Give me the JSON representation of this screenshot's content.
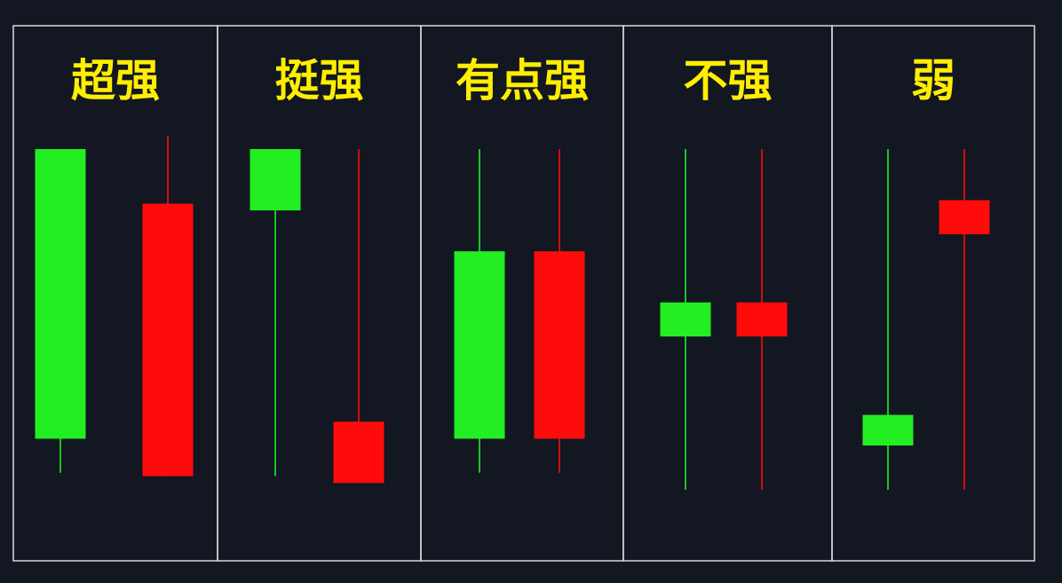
{
  "colors": {
    "background": "#121722",
    "panel_border": "#d8d8d8",
    "title": "#ffee00",
    "up": "#22ee22",
    "down": "#ff0b0b"
  },
  "panels": [
    {
      "title": "超强",
      "candles": [
        {
          "color": "up",
          "wick_top": 0,
          "wick_bottom": 0.95,
          "body_top": 0,
          "body_bottom": 0.85
        },
        {
          "color": "down",
          "wick_top": -0.04,
          "wick_bottom": 0.96,
          "body_top": 0.16,
          "body_bottom": 0.96
        }
      ]
    },
    {
      "title": "挺强",
      "candles": [
        {
          "color": "up",
          "wick_top": 0,
          "wick_bottom": 0.96,
          "body_top": 0,
          "body_bottom": 0.18
        },
        {
          "color": "down",
          "wick_top": 0,
          "wick_bottom": 0.98,
          "body_top": 0.8,
          "body_bottom": 0.98
        }
      ]
    },
    {
      "title": "有点强",
      "candles": [
        {
          "color": "up",
          "wick_top": 0,
          "wick_bottom": 0.95,
          "body_top": 0.3,
          "body_bottom": 0.85
        },
        {
          "color": "down",
          "wick_top": 0,
          "wick_bottom": 0.95,
          "body_top": 0.3,
          "body_bottom": 0.85
        }
      ]
    },
    {
      "title": "不强",
      "candles": [
        {
          "color": "up",
          "wick_top": 0,
          "wick_bottom": 1,
          "body_top": 0.45,
          "body_bottom": 0.55
        },
        {
          "color": "down",
          "wick_top": 0,
          "wick_bottom": 1,
          "body_top": 0.45,
          "body_bottom": 0.55
        }
      ]
    },
    {
      "title": "弱",
      "candles": [
        {
          "color": "up",
          "wick_top": 0,
          "wick_bottom": 1,
          "body_top": 0.78,
          "body_bottom": 0.87
        },
        {
          "color": "down",
          "wick_top": 0,
          "wick_bottom": 1,
          "body_top": 0.15,
          "body_bottom": 0.25
        }
      ]
    }
  ]
}
